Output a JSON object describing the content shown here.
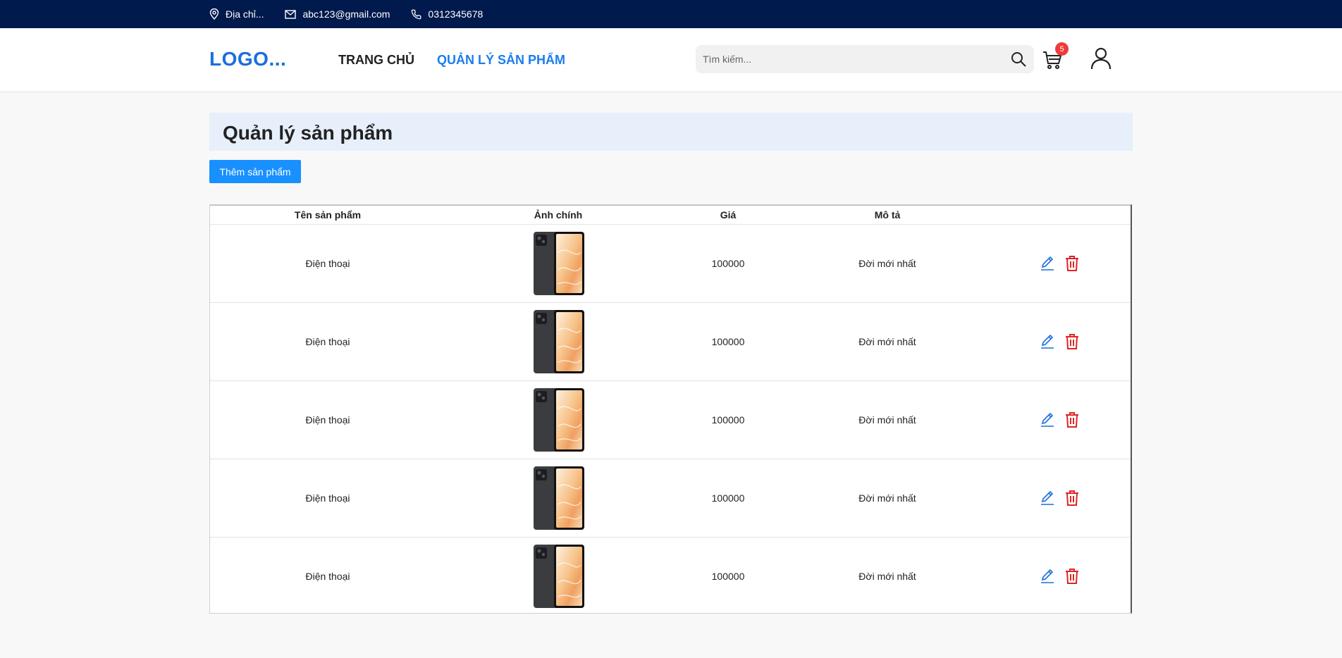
{
  "topbar": {
    "address": "Địa chỉ...",
    "email": "abc123@gmail.com",
    "phone": "0312345678"
  },
  "header": {
    "logo": "LOGO...",
    "nav": [
      {
        "label": "TRANG CHỦ",
        "active": false
      },
      {
        "label": "QUẢN LÝ SẢN PHẨM",
        "active": true
      }
    ],
    "search_placeholder": "Tìm kiếm...",
    "search_value": "",
    "cart_count": "5"
  },
  "page": {
    "title": "Quản lý sản phẩm",
    "add_button": "Thêm sản phẩm"
  },
  "table": {
    "headers": [
      "Tên sản phẩm",
      "Ảnh chính",
      "Giá",
      "Mô tả"
    ],
    "rows": [
      {
        "name": "Điện thoại",
        "price": "100000",
        "desc": "Đời mới nhất"
      },
      {
        "name": "Điện thoại",
        "price": "100000",
        "desc": "Đời mới nhất"
      },
      {
        "name": "Điện thoại",
        "price": "100000",
        "desc": "Đời mới nhất"
      },
      {
        "name": "Điện thoại",
        "price": "100000",
        "desc": "Đời mới nhất"
      },
      {
        "name": "Điện thoại",
        "price": "100000",
        "desc": "Đời mới nhất"
      }
    ]
  },
  "colors": {
    "topbar_bg": "#001a4d",
    "accent": "#1a7cf0",
    "button": "#1890ff",
    "delete": "#e02424",
    "badge": "#ee3b3b"
  },
  "icons": {
    "address": "map-pin-icon",
    "email": "mail-icon",
    "phone": "phone-icon",
    "search": "search-icon",
    "cart": "cart-icon",
    "user": "user-icon",
    "edit": "edit-icon",
    "delete": "trash-icon"
  }
}
